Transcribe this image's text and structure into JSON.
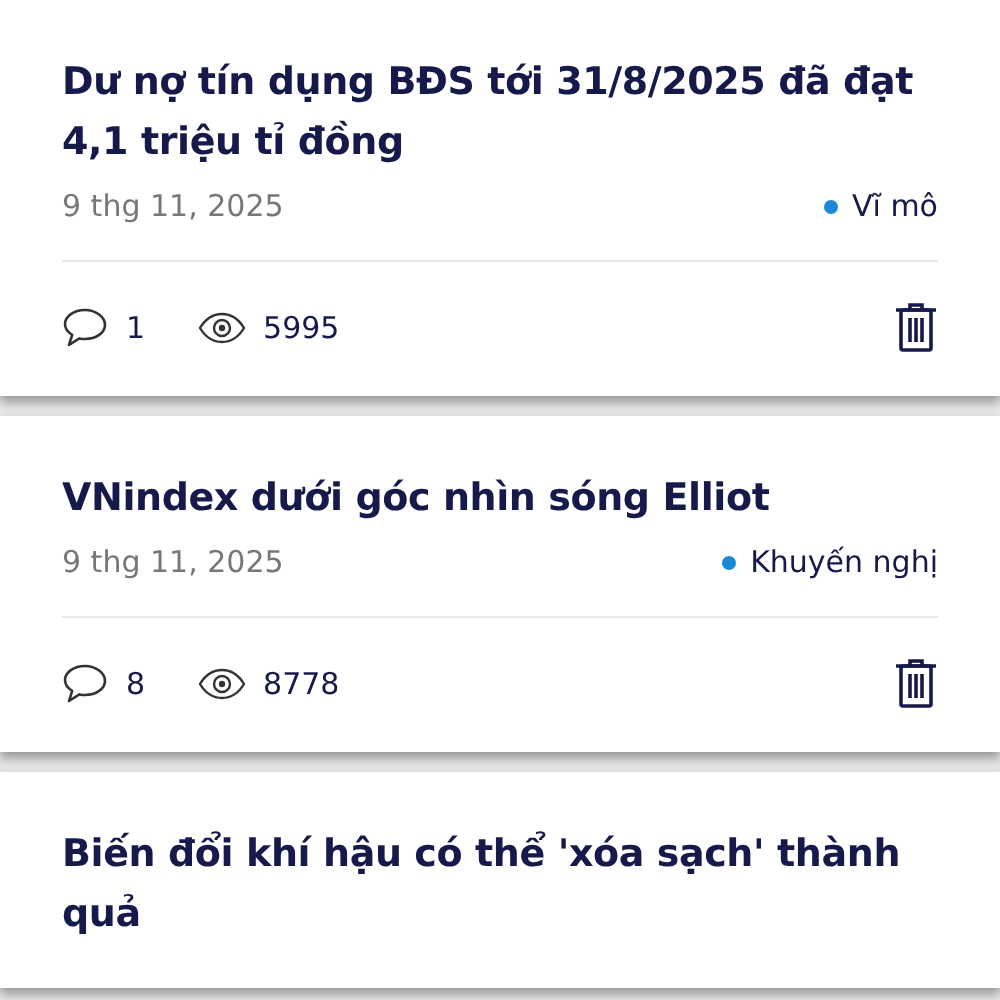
{
  "posts": [
    {
      "title": "Dư nợ tín dụng BĐS tới 31/8/2025 đã đạt 4,1 triệu tỉ đồng",
      "date": "9 thg 11, 2025",
      "category": {
        "label": "Vĩ mô",
        "color": "#1a8ad8"
      },
      "comments": "1",
      "views": "5995"
    },
    {
      "title": "VNindex dưới góc nhìn sóng Elliot",
      "date": "9 thg 11, 2025",
      "category": {
        "label": "Khuyến nghị",
        "color": "#1a8ad8"
      },
      "comments": "8",
      "views": "8778"
    },
    {
      "title": "Biến đổi khí hậu có thể 'xóa sạch' thành quả"
    }
  ]
}
